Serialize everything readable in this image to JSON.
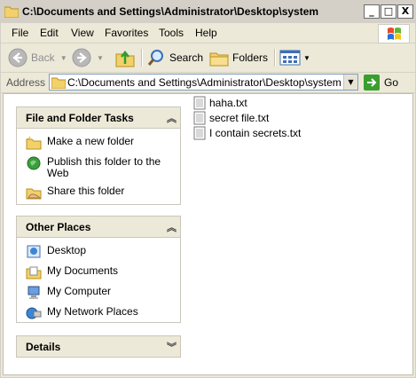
{
  "window": {
    "title": "C:\\Documents and Settings\\Administrator\\Desktop\\system",
    "controls": {
      "minimize": "_",
      "maximize": "□",
      "close": "X"
    }
  },
  "menu": [
    "File",
    "Edit",
    "View",
    "Favorites",
    "Tools",
    "Help"
  ],
  "toolbar": {
    "back": "Back",
    "search": "Search",
    "folders": "Folders"
  },
  "address": {
    "label": "Address",
    "value": "C:\\Documents and Settings\\Administrator\\Desktop\\system",
    "go": "Go"
  },
  "tasks_panel": {
    "title": "File and Folder Tasks",
    "items": [
      {
        "label": "Make a new folder",
        "icon": "new-folder-icon"
      },
      {
        "label": "Publish this folder to the Web",
        "icon": "publish-web-icon"
      },
      {
        "label": "Share this folder",
        "icon": "share-folder-icon"
      }
    ]
  },
  "places_panel": {
    "title": "Other Places",
    "items": [
      {
        "label": "Desktop",
        "icon": "desktop-icon"
      },
      {
        "label": "My Documents",
        "icon": "my-documents-icon"
      },
      {
        "label": "My Computer",
        "icon": "my-computer-icon"
      },
      {
        "label": "My Network Places",
        "icon": "network-places-icon"
      }
    ]
  },
  "details_panel": {
    "title": "Details"
  },
  "files": [
    {
      "name": "haha.txt"
    },
    {
      "name": "secret file.txt"
    },
    {
      "name": "I contain secrets.txt"
    }
  ],
  "colors": {
    "panel_head": "#ece9d8",
    "folder": "#f3d16a",
    "go_green": "#3a9e2f"
  }
}
